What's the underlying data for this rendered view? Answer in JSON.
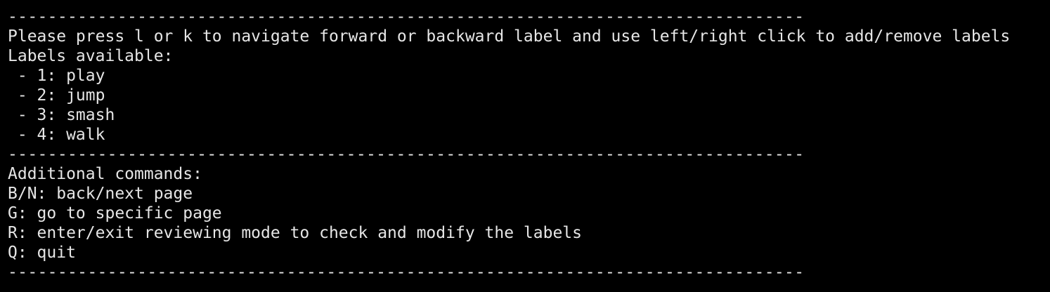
{
  "terminal": {
    "separator": "--------------------------------------------------------------------------------",
    "instruction": "Please press l or k to navigate forward or backward label and use left/right click to add/remove labels",
    "labels_heading": "Labels available:",
    "labels": [
      " - 1: play",
      " - 2: jump",
      " - 3: smash",
      " - 4: walk"
    ],
    "commands_heading": "Additional commands:",
    "commands": [
      "B/N: back/next page",
      "G: go to specific page",
      "R: enter/exit reviewing mode to check and modify the labels",
      "Q: quit"
    ]
  }
}
